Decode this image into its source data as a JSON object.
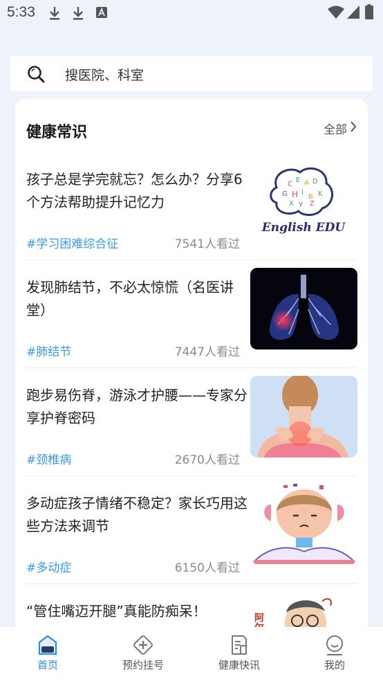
{
  "status_bar": {
    "time": "5:33"
  },
  "search": {
    "placeholder": "搜医院、科室"
  },
  "section": {
    "title": "健康常识",
    "view_all": "全部"
  },
  "articles": [
    {
      "title": "孩子总是学完就忘？怎么办？分享6个方法帮助提升记忆力",
      "tag": "#学习困难综合征",
      "views": "7541人看过",
      "thumb_text": "English EDU"
    },
    {
      "title": "发现肺结节，不必太惊慌（名医讲堂）",
      "tag": "#肺结节",
      "views": "7447人看过"
    },
    {
      "title": "跑步易伤脊，游泳才护腰——专家分享护脊密码",
      "tag": "#颈椎病",
      "views": "2670人看过"
    },
    {
      "title": "多动症孩子情绪不稳定？家长巧用这些方法来调节",
      "tag": "#多动症",
      "views": "6150人看过"
    },
    {
      "title": "“管住嘴迈开腿”真能防痴呆！",
      "tag": "",
      "views": "",
      "thumb_text": "阿尔兹"
    }
  ],
  "nav": [
    {
      "label": "首页",
      "icon": "home-icon",
      "active": true
    },
    {
      "label": "预约挂号",
      "icon": "appointment-icon",
      "active": false
    },
    {
      "label": "健康快讯",
      "icon": "news-icon",
      "active": false
    },
    {
      "label": "我的",
      "icon": "profile-icon",
      "active": false
    }
  ],
  "colors": {
    "accent": "#2b8be6",
    "tag": "#3a9ae8",
    "background": "#eef2fb"
  }
}
